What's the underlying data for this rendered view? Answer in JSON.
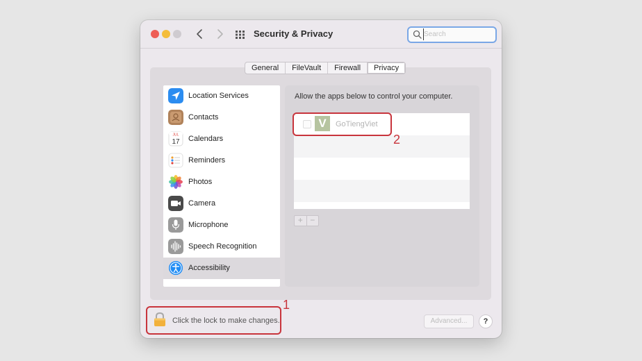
{
  "window": {
    "title": "Security & Privacy"
  },
  "search": {
    "placeholder": "Search"
  },
  "tabs": [
    {
      "label": "General"
    },
    {
      "label": "FileVault"
    },
    {
      "label": "Firewall"
    },
    {
      "label": "Privacy",
      "active": true
    }
  ],
  "sidebar": {
    "items": [
      {
        "label": "Location Services",
        "icon": "location-arrow-icon"
      },
      {
        "label": "Contacts",
        "icon": "contacts-icon"
      },
      {
        "label": "Calendars",
        "icon": "calendar-icon",
        "icon_month": "JUL",
        "icon_day": "17"
      },
      {
        "label": "Reminders",
        "icon": "reminders-icon"
      },
      {
        "label": "Photos",
        "icon": "photos-icon"
      },
      {
        "label": "Camera",
        "icon": "camera-icon"
      },
      {
        "label": "Microphone",
        "icon": "microphone-icon"
      },
      {
        "label": "Speech Recognition",
        "icon": "waveform-icon"
      },
      {
        "label": "Accessibility",
        "icon": "accessibility-icon",
        "selected": true
      }
    ]
  },
  "privacy_panel": {
    "description": "Allow the apps below to control your computer.",
    "apps": [
      {
        "name": "GoTiengViet",
        "icon_letter": "V",
        "checked": false
      }
    ],
    "add_label": "+",
    "remove_label": "−"
  },
  "footer": {
    "lock_text": "Click the lock to make changes.",
    "advanced_label": "Advanced...",
    "help_label": "?"
  },
  "annotations": {
    "one": "1",
    "two": "2"
  },
  "colors": {
    "annotation": "#c8343c",
    "search_focus": "#7aa7e6",
    "accessibility_blue": "#1f8cf5"
  }
}
